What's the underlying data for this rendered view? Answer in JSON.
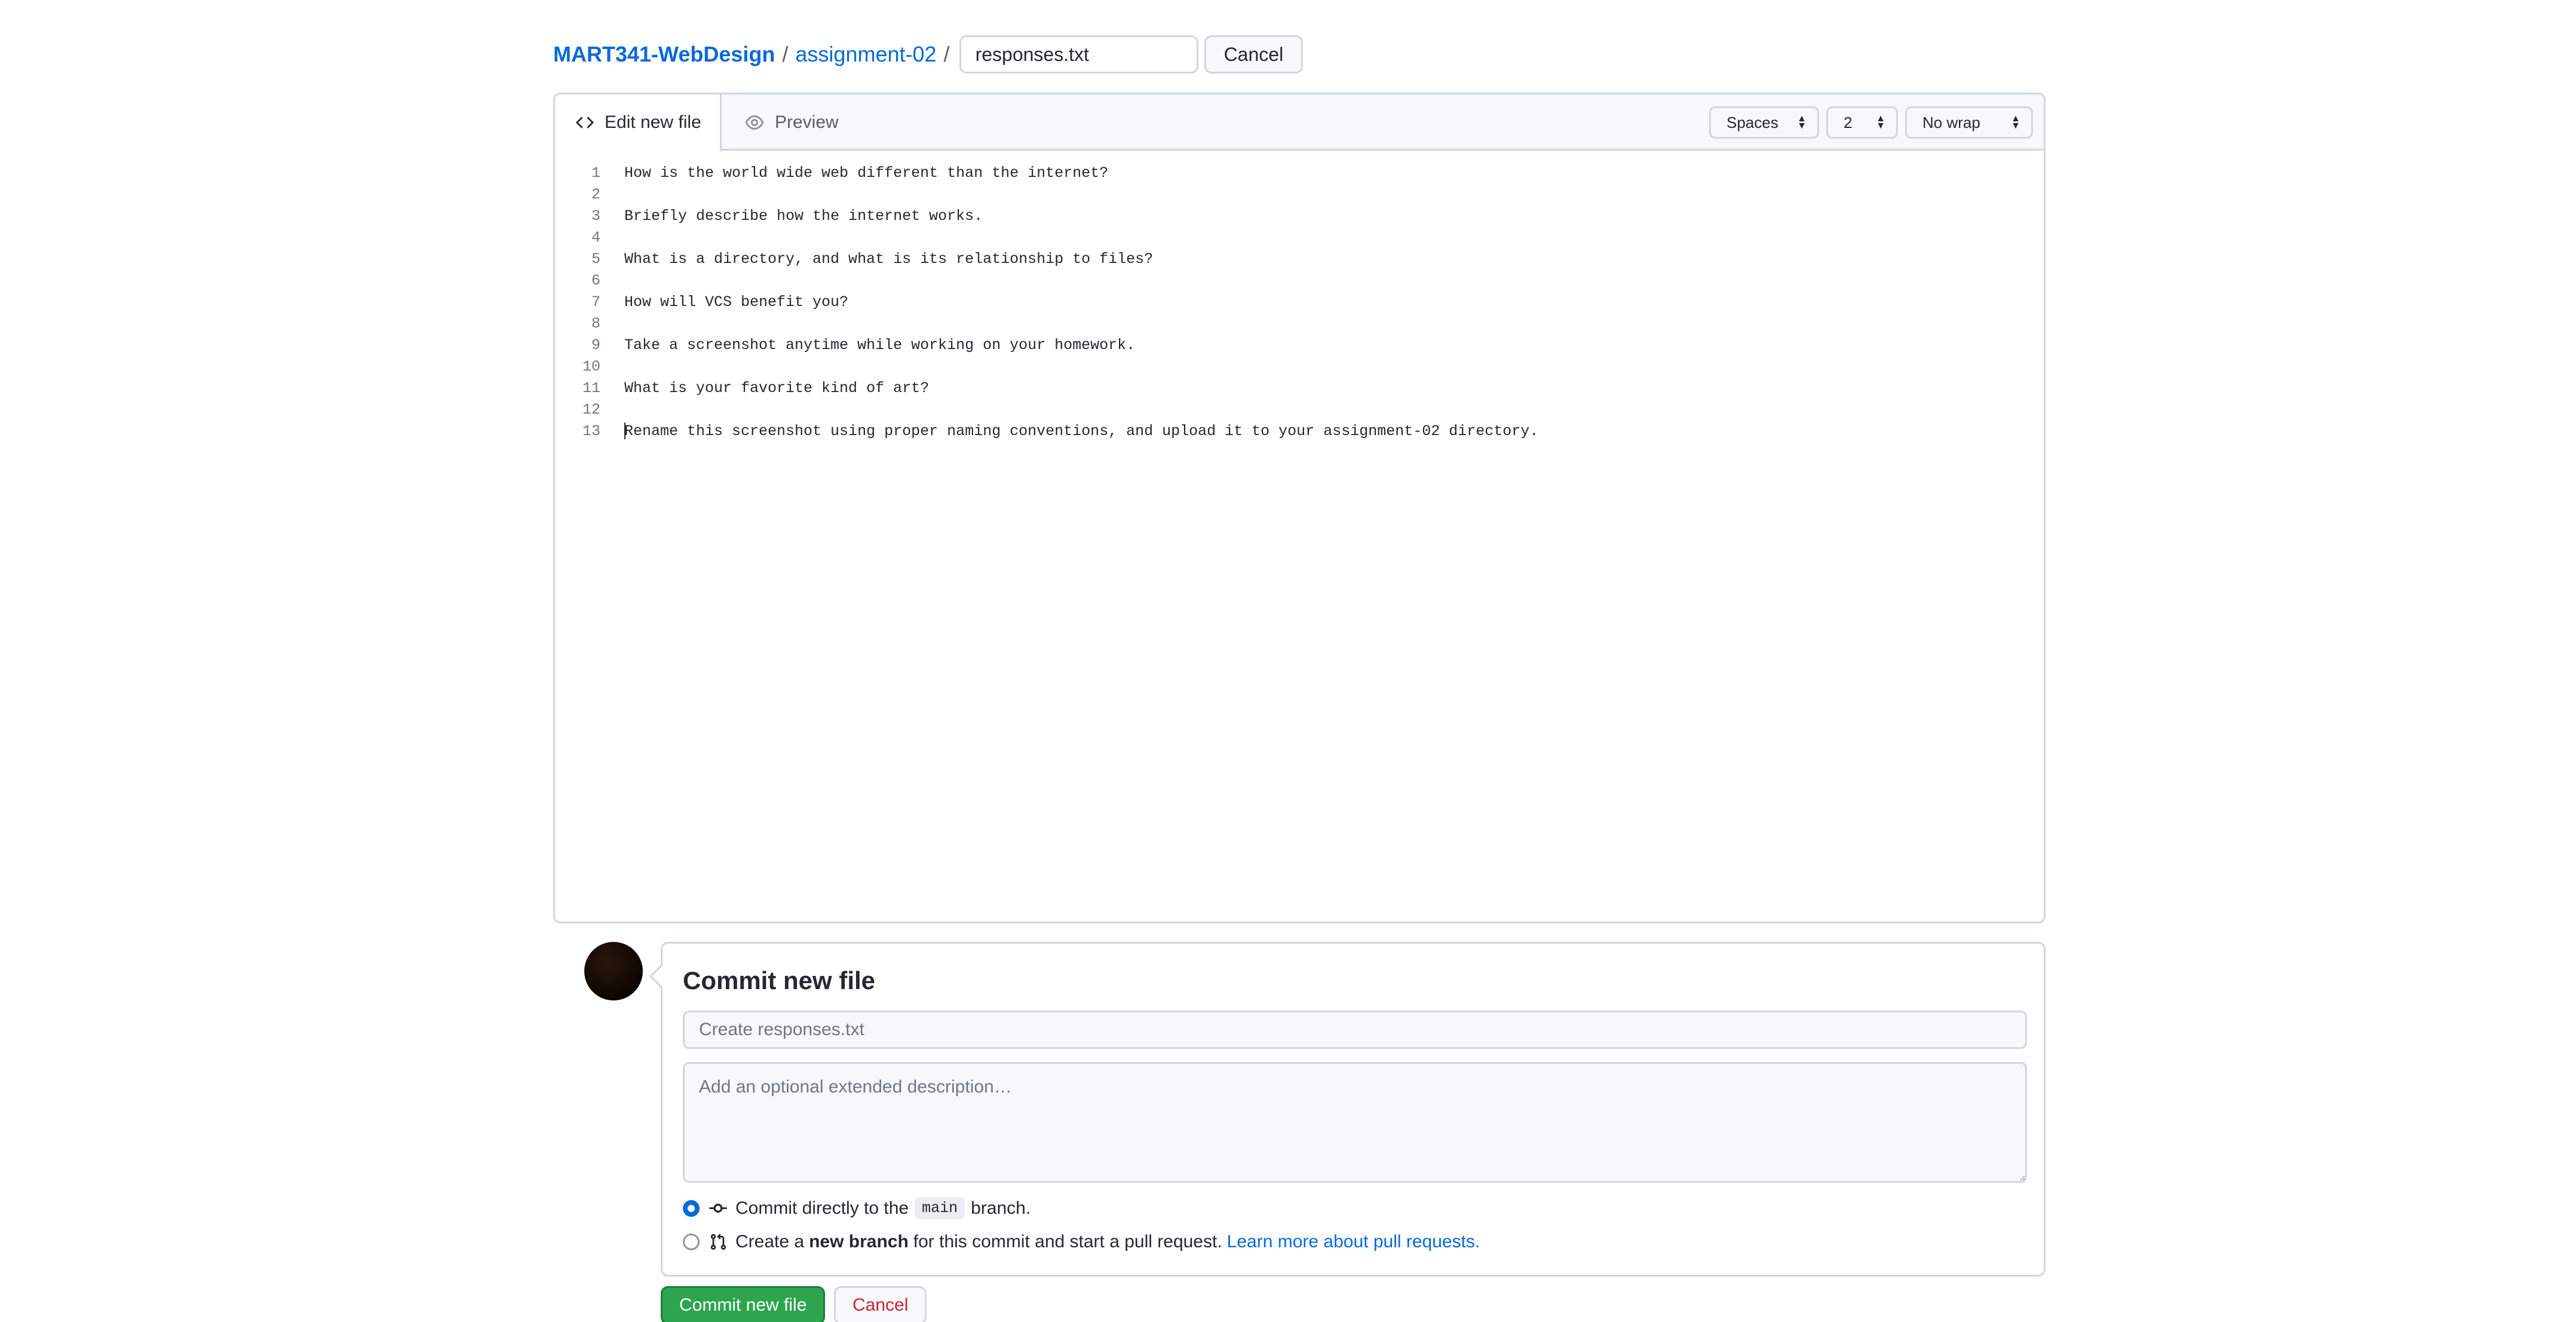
{
  "breadcrumb": {
    "repo": "MART341-WebDesign",
    "sep1": "/",
    "folder": "assignment-02",
    "sep2": "/"
  },
  "filename_input": {
    "value": "responses.txt"
  },
  "cancel_top_label": "Cancel",
  "editor": {
    "tab_edit_label": "Edit new file",
    "tab_preview_label": "Preview",
    "indent_mode": "Spaces",
    "indent_size": "2",
    "wrap_mode": "No wrap",
    "lines": [
      {
        "num": "1",
        "text": "How is the world wide web different than the internet?"
      },
      {
        "num": "2",
        "text": ""
      },
      {
        "num": "3",
        "text": "Briefly describe how the internet works."
      },
      {
        "num": "4",
        "text": ""
      },
      {
        "num": "5",
        "text": "What is a directory, and what is its relationship to files?"
      },
      {
        "num": "6",
        "text": ""
      },
      {
        "num": "7",
        "text": "How will VCS benefit you?"
      },
      {
        "num": "8",
        "text": ""
      },
      {
        "num": "9",
        "text": "Take a screenshot anytime while working on your homework."
      },
      {
        "num": "10",
        "text": ""
      },
      {
        "num": "11",
        "text": "What is your favorite kind of art?"
      },
      {
        "num": "12",
        "text": ""
      },
      {
        "num": "13",
        "text": "Rename this screenshot using proper naming conventions, and upload it to your assignment-02 directory."
      }
    ]
  },
  "commit": {
    "title": "Commit new file",
    "message_placeholder": "Create responses.txt",
    "description_placeholder": "Add an optional extended description…",
    "option_direct": {
      "prefix": "Commit directly to the",
      "branch": "main",
      "suffix": "branch."
    },
    "option_new_branch": {
      "prefix": "Create a",
      "bold": "new branch",
      "suffix": "for this commit and start a pull request.",
      "link": "Learn more about pull requests."
    },
    "submit_label": "Commit new file",
    "cancel_label": "Cancel"
  },
  "colors": {
    "link": "#0969da",
    "primary_button": "#2da44e",
    "danger_text": "#cf222e",
    "border": "#d0d7de"
  }
}
